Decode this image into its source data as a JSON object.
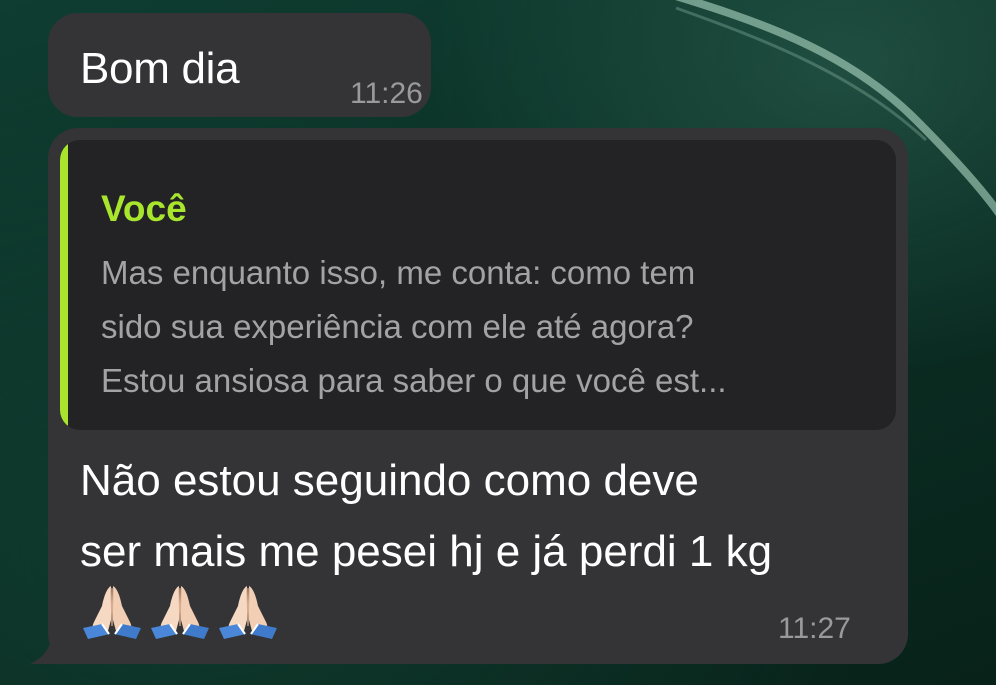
{
  "messages": [
    {
      "text": "Bom dia",
      "time": "11:26"
    },
    {
      "quote": {
        "author": "Você",
        "lines": [
          "Mas enquanto isso, me conta: como tem",
          "sido sua experiência com ele até agora?",
          "Estou ansiosa para saber o que você est..."
        ]
      },
      "lines": [
        "Não estou seguindo como deve",
        "ser mais me pesei hj e já perdi 1 kg"
      ],
      "emojis": [
        "folded-hands-icon",
        "folded-hands-icon",
        "folded-hands-icon"
      ],
      "time": "11:27"
    }
  ],
  "colors": {
    "bubble": "#343436",
    "quote_background": "#232325",
    "accent": "#a8e52c",
    "timestamp": "#9a9a9e"
  }
}
